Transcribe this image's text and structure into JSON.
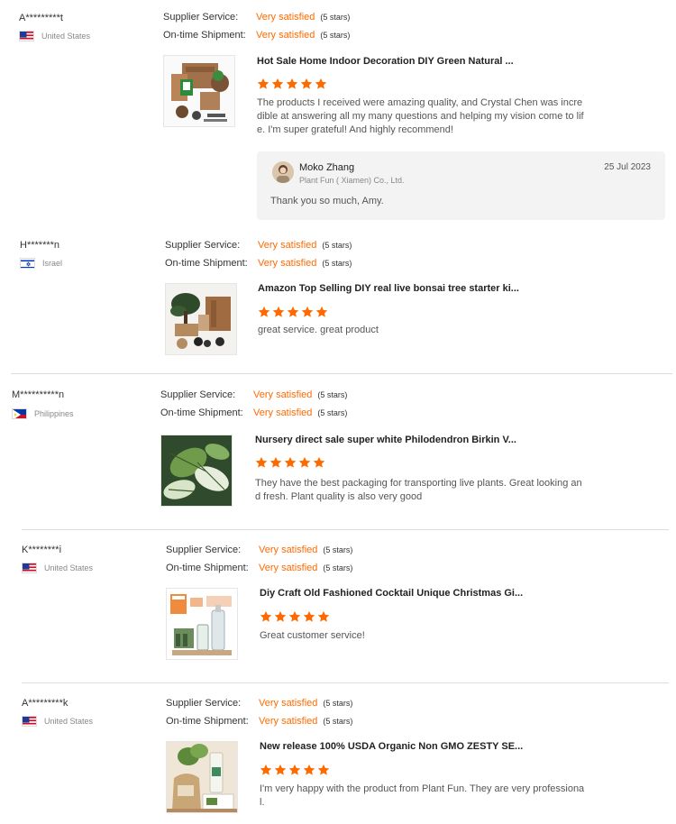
{
  "labels": {
    "supplier_service": "Supplier Service:",
    "ontime_shipment": "On-time Shipment:",
    "very_satisfied": "Very satisfied",
    "five_stars": "(5 stars)"
  },
  "star_color": "#ff6a00",
  "reviews": [
    {
      "buyer": "A*********t",
      "country": "United States",
      "flag": "us",
      "product_title": "Hot Sale Home Indoor Decoration DIY Green Natural ...",
      "rating": 5,
      "text": "The products I received were amazing quality, and Crystal Chen was incredible at answering all my many questions and helping my vision come to life. I'm super grateful! And highly recommend!",
      "reply": {
        "name": "Moko Zhang",
        "company": "Plant Fun ( Xiamen) Co., Ltd.",
        "date": "25 Jul 2023",
        "text": "Thank you so much, Amy."
      }
    },
    {
      "buyer": "H*******n",
      "country": "Israel",
      "flag": "il",
      "product_title": "Amazon Top Selling DIY real live bonsai tree starter ki...",
      "rating": 5,
      "text": "great service. great product"
    },
    {
      "buyer": "M**********n",
      "country": "Philippines",
      "flag": "ph",
      "product_title": "Nursery direct sale super white Philodendron Birkin V...",
      "rating": 5,
      "text": "They have the best packaging for transporting live plants. Great looking and fresh. Plant quality is also very good"
    },
    {
      "buyer": "K********i",
      "country": "United States",
      "flag": "us",
      "product_title": "Diy Craft Old Fashioned Cocktail Unique Christmas Gi...",
      "rating": 5,
      "text": "Great customer service!"
    },
    {
      "buyer": "A*********k",
      "country": "United States",
      "flag": "us",
      "product_title": "New release 100% USDA Organic Non GMO ZESTY SE...",
      "rating": 5,
      "text": "I'm very happy with the product from Plant Fun. They are very professional."
    }
  ]
}
